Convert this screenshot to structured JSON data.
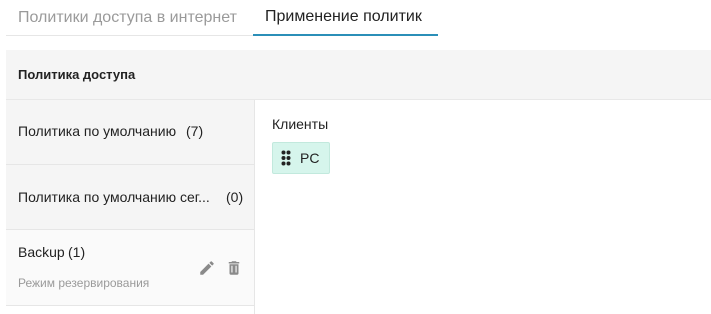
{
  "tabs": [
    {
      "label": "Политики доступа в интернет",
      "active": false
    },
    {
      "label": "Применение политик",
      "active": true
    }
  ],
  "panel": {
    "header": "Политика доступа"
  },
  "policies": [
    {
      "label": "Политика по умолчанию",
      "count": "(7)"
    },
    {
      "label": "Политика по умолчанию сег...",
      "count": "(0)"
    },
    {
      "label": "Backup",
      "count": "(1)",
      "subtitle": "Режим резервирования"
    }
  ],
  "clients": {
    "title": "Клиенты",
    "chips": [
      {
        "label": "PC",
        "icon": "drag-handle-icon"
      }
    ]
  },
  "colors": {
    "accent": "#2b8fb8",
    "chip_bg": "#d6f5ec",
    "header_bg": "#f5f5f5"
  }
}
